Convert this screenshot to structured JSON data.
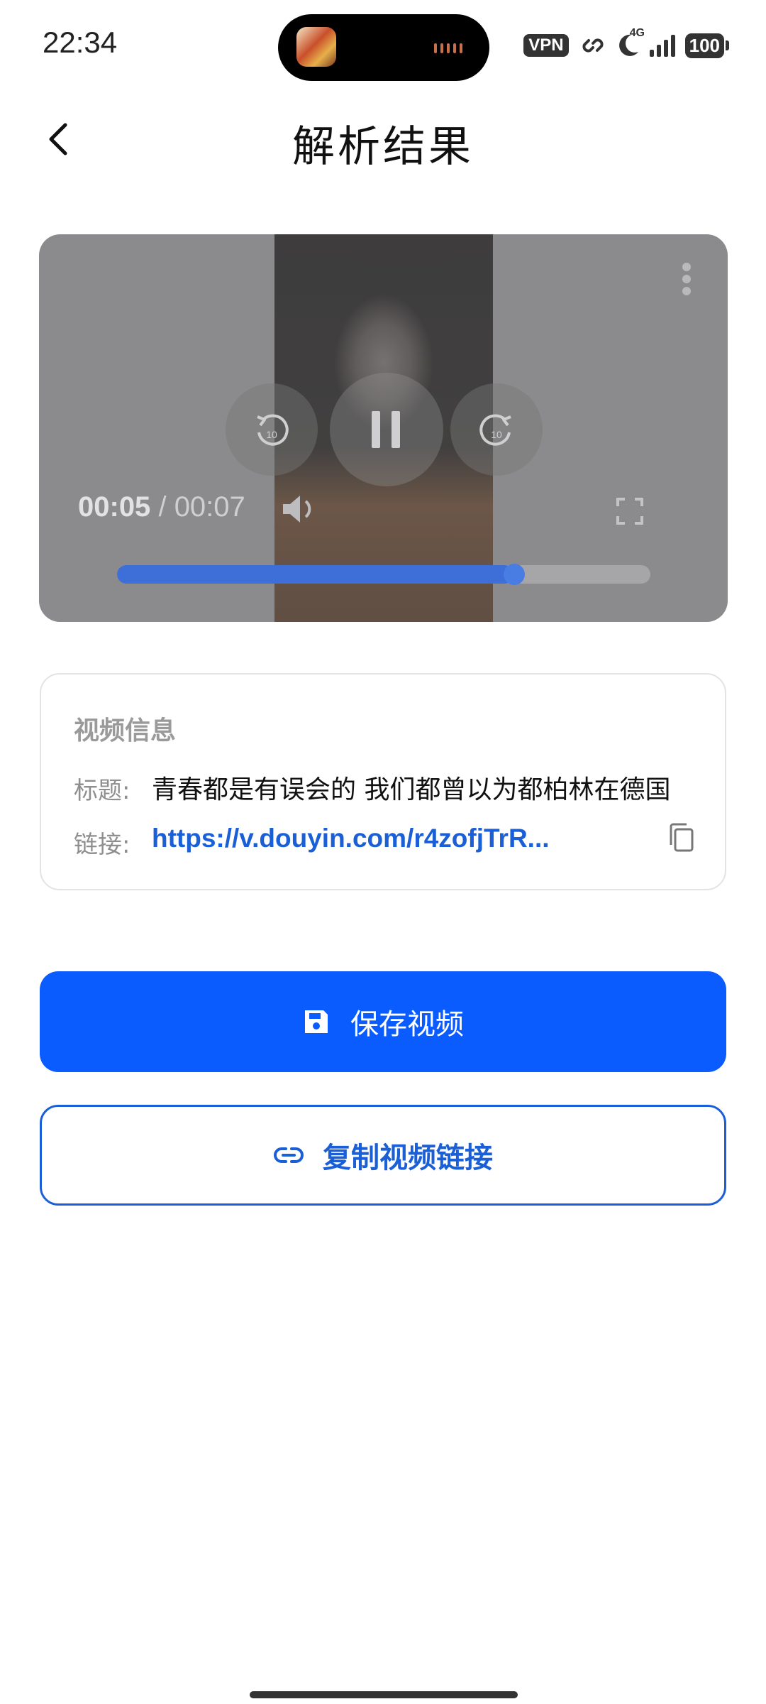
{
  "status_bar": {
    "time": "22:34",
    "vpn": "VPN",
    "network": "4G",
    "battery": "100"
  },
  "header": {
    "title": "解析结果"
  },
  "player": {
    "current_time": "00:05",
    "separator": "/",
    "duration": "00:07",
    "skip_seconds": "10",
    "progress_fraction": 0.745
  },
  "info": {
    "heading": "视频信息",
    "title_label": "标题:",
    "title_value": "青春都是有误会的 我们都曾以为都柏林在德国",
    "link_label": "链接:",
    "link_value": "https://v.douyin.com/r4zofjTrR..."
  },
  "actions": {
    "save_label": "保存视频",
    "copy_link_label": "复制视频链接"
  },
  "colors": {
    "primary": "#0a5cff",
    "link": "#1a5fd6"
  }
}
